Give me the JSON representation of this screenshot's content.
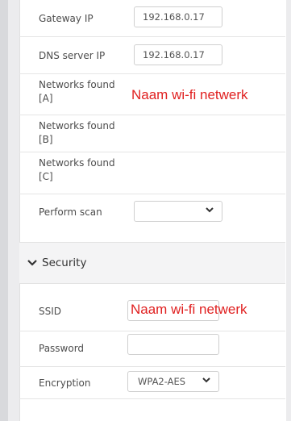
{
  "network": {
    "gateway_label": "Gateway IP",
    "gateway_value": "192.168.0.17",
    "dns_label": "DNS server IP",
    "dns_value": "192.168.0.17",
    "nets_a_label": "Networks found [A]",
    "nets_a_value": "Naam wi-fi netwerk",
    "nets_b_label": "Networks found [B]",
    "nets_c_label": "Networks found [C]",
    "scan_label": "Perform scan",
    "scan_value": ""
  },
  "security": {
    "section_label": "Security",
    "ssid_label": "SSID",
    "ssid_value": "Naam wi-fi netwerk",
    "password_label": "Password",
    "password_value": "",
    "encryption_label": "Encryption",
    "encryption_value": "WPA2-AES"
  },
  "icons": {
    "section_chevron": "chevron-down-icon",
    "select_chevron": "chevron-down-icon"
  },
  "colors": {
    "overlay_text": "#e02020",
    "section_header_bg": "#f4f4f5"
  }
}
